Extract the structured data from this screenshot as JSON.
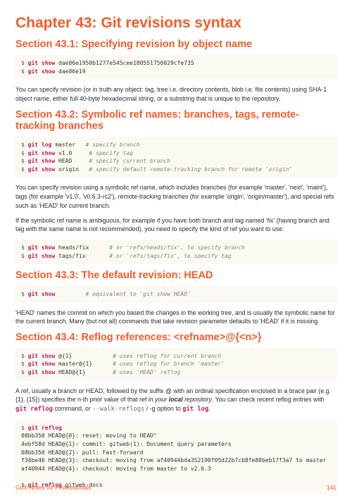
{
  "chapter": {
    "title": "Chapter 43: Git revisions syntax"
  },
  "sec1": {
    "title": "Section 43.1: Specifying revision by object name",
    "code": {
      "l1p": "$",
      "l1c": "git show",
      "l1a": " dae86e1950b1277e545cee180551750029cfe735",
      "l2p": "$",
      "l2c": "git show",
      "l2a": " dae86e19"
    },
    "p1": "You can specify revision (or in truth any object: tag, tree i.e. directory contents, blob i.e. file contents) using SHA-1 object name, either full 40-byte hexadecimal string, or a substring that is unique to the repository."
  },
  "sec2": {
    "title": "Section 43.2: Symbolic ref names: branches, tags, remote-tracking branches",
    "codeA": {
      "l1p": "$",
      "l1c": "git log",
      "l1a": " master   ",
      "l1x": "# specify branch",
      "l2p": "$",
      "l2c": "git show",
      "l2a": " v1.0     ",
      "l2x": "# specify tag",
      "l3p": "$",
      "l3c": "git show",
      "l3a": " HEAD     ",
      "l3x": "# specify current branch",
      "l4p": "$",
      "l4c": "git show",
      "l4a": " origin   ",
      "l4x": "# specify default remote-tracking branch for remote 'origin'"
    },
    "p1": "You can specify revision using a symbolic ref name, which includes branches (for example 'master', 'next', 'maint'), tags (for example 'v1.0', 'v0.6.3-rc2'), remote-tracking branches (for example 'origin', 'origin/master'), and special refs such as 'HEAD' for current branch.",
    "p2": "If the symbolic ref name is ambiguous, for example if you have both branch and tag named 'fix' (having branch and tag with the same name is not recommended), you need to specify the kind of ref you want to use:",
    "codeB": {
      "l1p": "$",
      "l1c": "git show",
      "l1a": " heads/fix      ",
      "l1x": "# or 'refs/heads/fix', to specify branch",
      "l2p": "$",
      "l2c": "git show",
      "l2a": " tags/fix       ",
      "l2x": "# or 'refs/tags/fix', to specify tag"
    }
  },
  "sec3": {
    "title": "Section 43.3: The default revision: HEAD",
    "code": {
      "l1p": "$",
      "l1c": "git show",
      "l1a": "         ",
      "l1x": "# equivalent to 'git show HEAD'"
    },
    "p1": "'HEAD' names the commit on which you based the changes in the working tree, and is usually the symbolic name for the current branch. Many (but not all) commands that take revision parameter defaults to 'HEAD' if it is missing."
  },
  "sec4": {
    "title": "Section 43.4: Reflog references: <refname>@{<n>}",
    "codeA": {
      "l1p": "$",
      "l1c": "git show",
      "l1a": " @{1}            ",
      "l1x": "# uses reflog for current branch",
      "l2p": "$",
      "l2c": "git show",
      "l2a": " master@{1}      ",
      "l2x": "# uses reflog for branch 'master'",
      "l3p": "$",
      "l3c": "git show",
      "l3a": " HEAD@{1}        ",
      "l3x": "# uses 'HEAD' reflog"
    },
    "p1_pre": "A ref, usually a branch or HEAD, followed by the suffix @ with an ordinal specification enclosed in a brace pair (e.g. {1}, {15}) specifies the n-th prior value of that ref ",
    "p1_em": "in your ",
    "p1_strong": "local",
    "p1_em2": " repository",
    "p1_mid": ". You can check recent reflog entries with ",
    "p1_code1": "git reflog",
    "p1_mid2": " command, or ",
    "p1_flag": "--walk-reflogs",
    "p1_mid3": " / -g option to ",
    "p1_code2": "git log",
    "p1_end": ".",
    "codeB": {
      "l1p": "$",
      "l1c": "git reflog",
      "l1a": "",
      "l2": "08bb350 HEAD@{0}: reset: moving to HEAD^",
      "l3": "4ebf58d HEAD@{1}: commit: gitweb(1): Document query parameters",
      "l4": "08bb350 HEAD@{2}: pull: Fast-forward",
      "l5": "f34be46 HEAD@{3}: checkout: moving from af40944bda352190f05d22b7cb8fe88beb17f3a7 to master",
      "l6": "af40944 HEAD@{4}: checkout: moving from master to v2.6.3",
      "l7": "",
      "l8p": "$",
      "l8c": "git reflog",
      "l8a": " gitweb-docs"
    }
  },
  "footer": {
    "left": "Git® Notes for Professionals",
    "right": "141"
  }
}
